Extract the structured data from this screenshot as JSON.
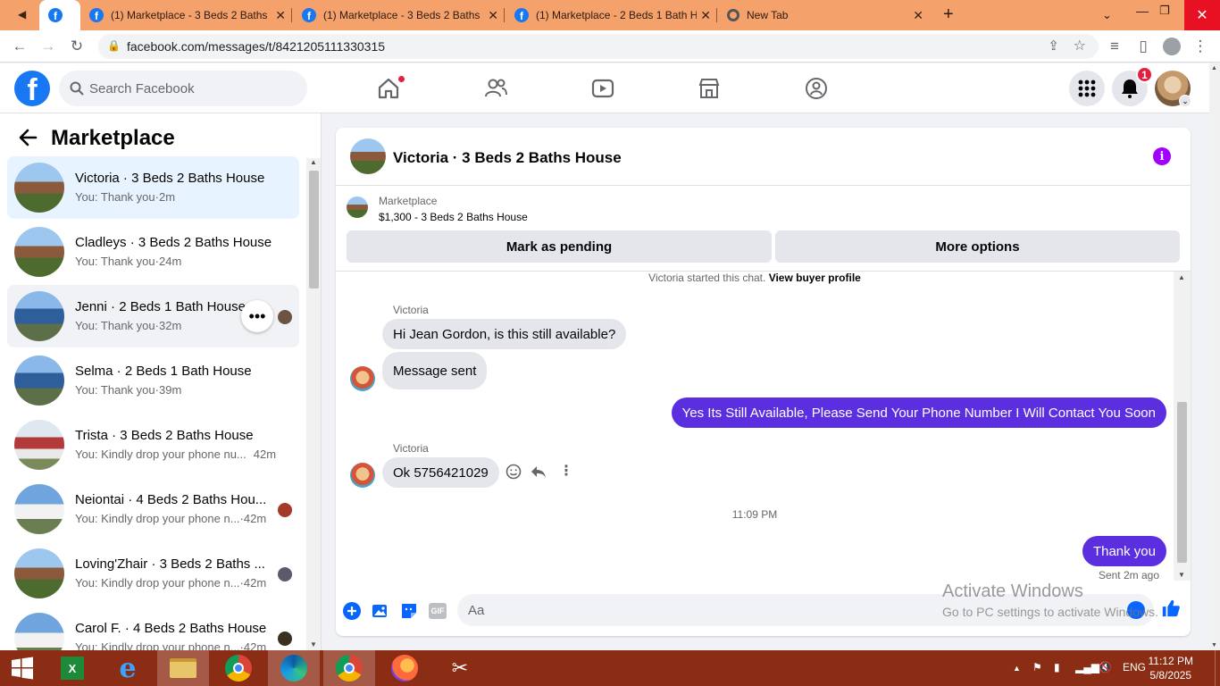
{
  "browser": {
    "tabs": [
      {
        "title": "",
        "active": true
      },
      {
        "title": "(1) Marketplace - 3 Beds 2 Baths"
      },
      {
        "title": "(1) Marketplace - 3 Beds 2 Baths"
      },
      {
        "title": "(1) Marketplace - 2 Beds 1 Bath H"
      },
      {
        "title": "New Tab"
      }
    ],
    "url": "facebook.com/messages/t/8421205111330315"
  },
  "header": {
    "search_placeholder": "Search Facebook",
    "notification_count": "1"
  },
  "sidebar": {
    "title": "Marketplace",
    "conversations": [
      {
        "title": "Victoria · 3 Beds 2 Baths House",
        "preview": "You: Thank you",
        "time": "2m",
        "selected": true
      },
      {
        "title": "Cladleys · 3 Beds 2 Baths House",
        "preview": "You: Thank you",
        "time": "24m"
      },
      {
        "title": "Jenni · 2 Beds 1 Bath House",
        "preview": "You: Thank you",
        "time": "32m",
        "hovered": true
      },
      {
        "title": "Selma · 2 Beds 1 Bath House",
        "preview": "You: Thank you",
        "time": "39m"
      },
      {
        "title": "Trista · 3 Beds 2 Baths House",
        "preview": "You: Kindly drop your phone nu...",
        "time": "42m"
      },
      {
        "title": "Neiontai · 4 Beds 2 Baths Hou...",
        "preview": "You: Kindly drop your phone n...",
        "time": "42m"
      },
      {
        "title": "Loving'Zhair · 3 Beds 2 Baths ...",
        "preview": "You: Kindly drop your phone n...",
        "time": "42m"
      },
      {
        "title": "Carol F. · 4 Beds 2 Baths House",
        "preview": "You: Kindly drop your phone n...",
        "time": "42m"
      }
    ]
  },
  "chat": {
    "title": "Victoria · 3 Beds 2 Baths House",
    "listing_label": "Marketplace",
    "listing_price": "$1,300 - 3 Beds 2 Baths House",
    "mark_pending_label": "Mark as pending",
    "more_options_label": "More options",
    "started_text": "Victoria started this chat.",
    "buyer_profile_link": "View buyer profile",
    "messages": [
      {
        "sender": "Victoria",
        "text": "Hi Jean Gordon, is this still available?"
      },
      {
        "text": "Message sent"
      },
      {
        "text": "Yes Its Still Available, Please Send Your Phone Number I Will Contact You Soon",
        "outgoing": true
      },
      {
        "sender": "Victoria",
        "text": "Ok 5756421029"
      },
      {
        "text": "Thank you",
        "outgoing": true
      }
    ],
    "timestamp": "11:09 PM",
    "sent_status": "Sent 2m ago",
    "input_placeholder": "Aa",
    "gif_label": "GIF"
  },
  "watermark": {
    "line1": "Activate Windows",
    "line2": "Go to PC settings to activate Windows."
  },
  "taskbar": {
    "language": "ENG",
    "time": "11:12 PM",
    "date": "5/8/2025"
  },
  "colors": {
    "accent": "#1877f2",
    "outgoing_bubble": "#5b2fe0",
    "tabstrip": "#f5a16c",
    "taskbar": "#8b2c14"
  }
}
